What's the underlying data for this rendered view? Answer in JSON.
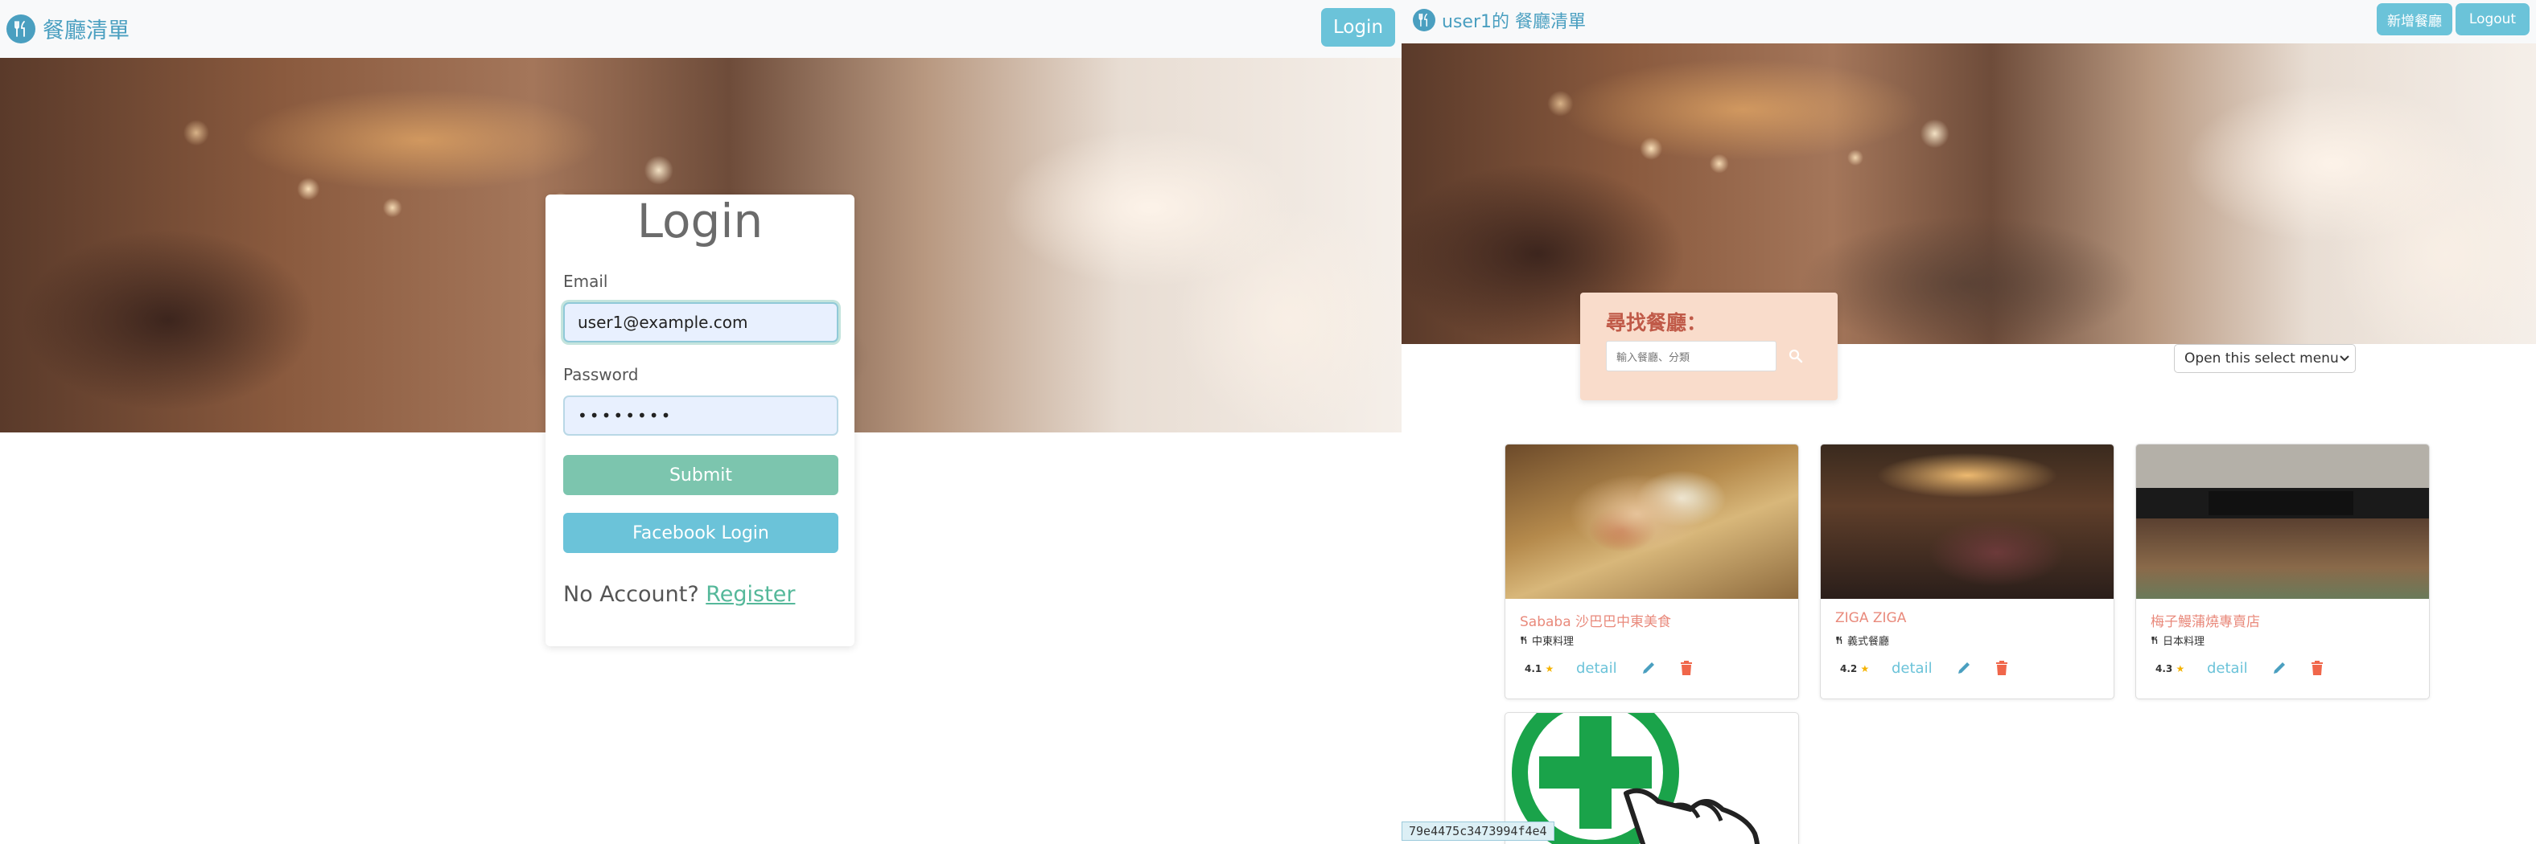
{
  "left": {
    "navbar": {
      "brand": "餐廳清單",
      "login_button": "Login"
    },
    "login": {
      "title": "Login",
      "email_label": "Email",
      "email_value": "user1@example.com",
      "password_label": "Password",
      "password_value": "••••••••",
      "submit_button": "Submit",
      "facebook_button": "Facebook Login",
      "no_account_text": "No Account?",
      "register_link": "Register"
    }
  },
  "right": {
    "navbar": {
      "brand": "user1的 餐廳清單",
      "add_button": "新增餐廳",
      "logout_button": "Logout"
    },
    "search": {
      "title": "尋找餐廳：",
      "placeholder": "輸入餐廳、分類"
    },
    "sort_select": {
      "selected": "Open this select menu"
    },
    "restaurants": [
      {
        "name": "Sababa 沙巴巴中東美食",
        "category": "中東料理",
        "rating": "4.1",
        "detail": "detail"
      },
      {
        "name": "ZIGA ZIGA",
        "category": "義式餐廳",
        "rating": "4.2",
        "detail": "detail"
      },
      {
        "name": "梅子鰻蒲燒專賣店",
        "category": "日本料理",
        "rating": "4.3",
        "detail": "detail"
      }
    ],
    "hash_tag": "79e4475c3473994f4e4"
  },
  "colors": {
    "accent": "#6bc3d9",
    "brand": "#4a9fc0",
    "submit": "#7cc5ae",
    "search_bg": "#f9dccb",
    "restaurant_name": "#e98a7c",
    "trash": "#f0664a"
  },
  "icons": [
    "utensils-icon",
    "search-icon",
    "chevron-down-icon",
    "star-icon",
    "pencil-icon",
    "trash-icon",
    "plus-icon",
    "hand-pointer-icon"
  ]
}
